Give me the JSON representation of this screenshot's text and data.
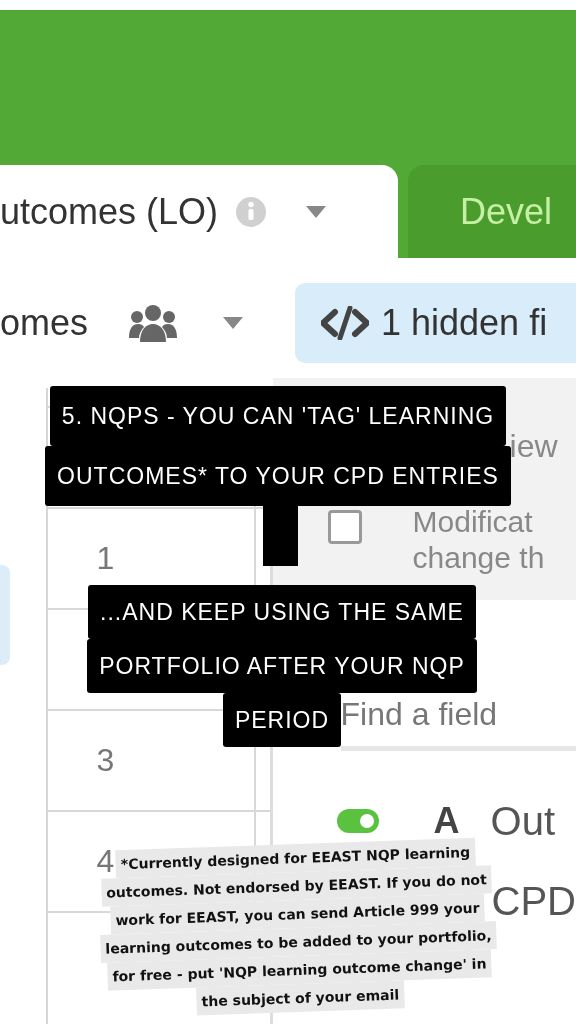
{
  "tabs": [
    {
      "label": "utcomes (LO)",
      "selected": true
    },
    {
      "label": "Devel",
      "selected": false
    }
  ],
  "view": {
    "name": "omes"
  },
  "hidden_fields": {
    "label": "1 hidden fi"
  },
  "grid": {
    "rows": [
      {
        "number": "1"
      },
      {
        "number": "3"
      },
      {
        "number": "4"
      }
    ]
  },
  "panel": {
    "notice": [
      "iew",
      "Modificat",
      "change th"
    ],
    "notice_checked": false,
    "search": {
      "placeholder": "Find a field"
    },
    "fields": [
      {
        "on": true,
        "type_letter": "A",
        "name": "Out"
      }
    ],
    "partial_field": "CPD"
  },
  "captions": [
    {
      "lines": [
        "5. NQPS - YOU CAN 'TAG' LEARNING",
        "OUTCOMES* TO YOUR CPD ENTRIES"
      ]
    },
    {
      "lines": [
        "...AND KEEP USING THE SAME",
        "PORTFOLIO AFTER YOUR NQP",
        "PERIOD"
      ]
    }
  ],
  "footnote": {
    "lines": [
      "*Currently designed for EEAST NQP learning",
      "outcomes. Not endorsed by EEAST. If you do not",
      "work for EEAST, you can send Article 999 your",
      "learning outcomes to be added to your portfolio,",
      "for free - put 'NQP learning outcome change' in",
      "the subject of your email"
    ]
  }
}
